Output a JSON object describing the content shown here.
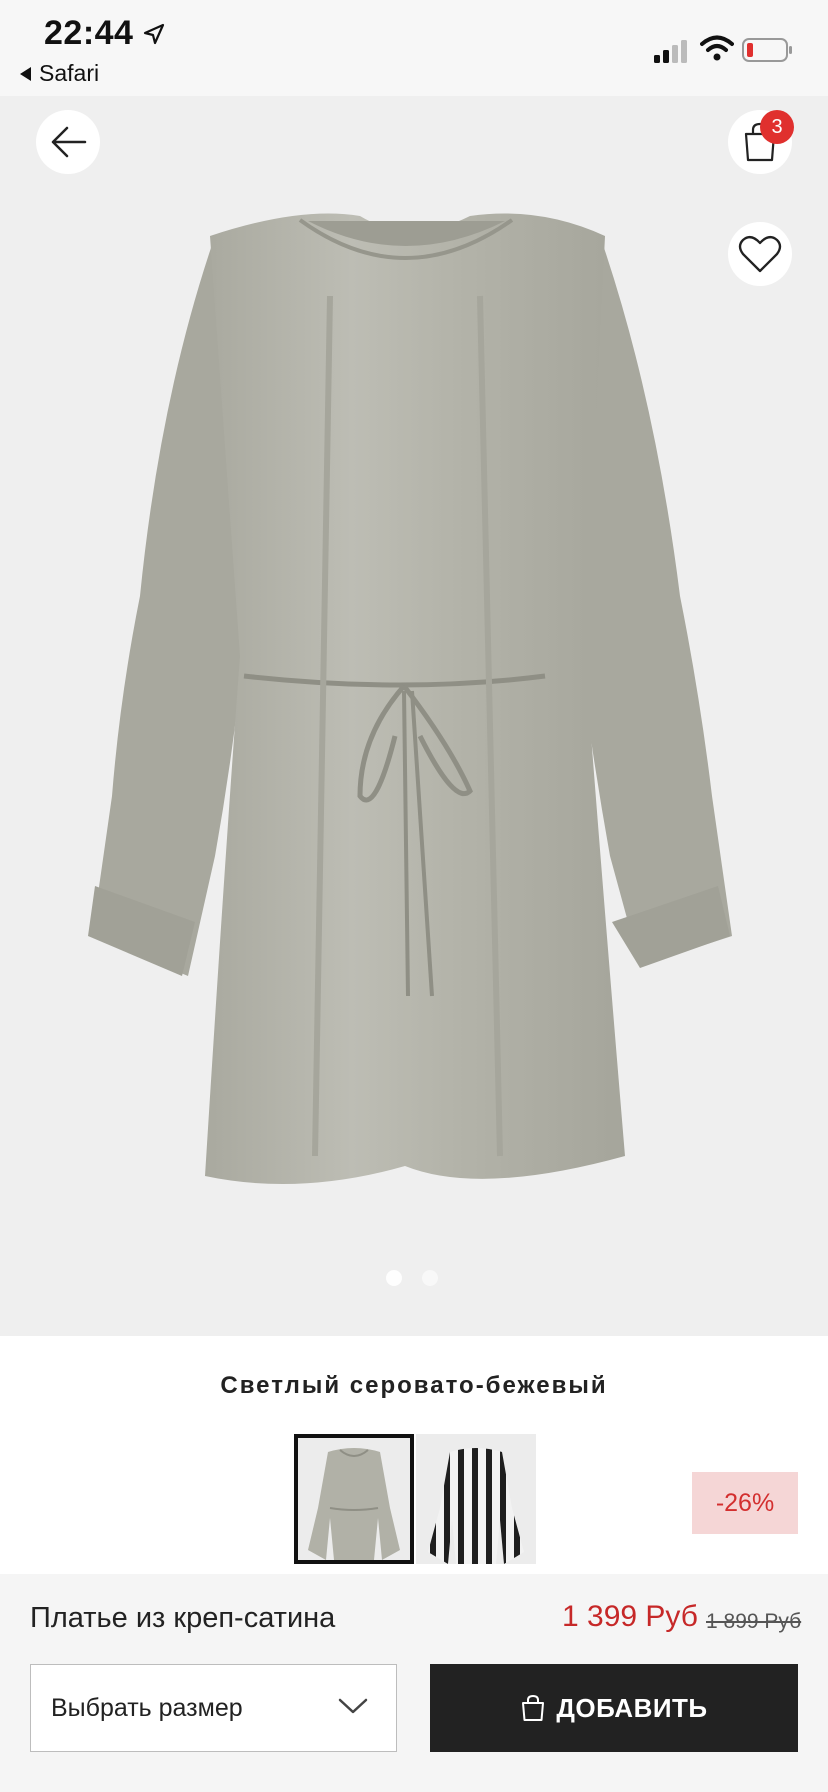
{
  "status_bar": {
    "time": "22:44",
    "back_app": "Safari",
    "icons": [
      "location-arrow-icon",
      "cellular-signal-icon",
      "wifi-icon",
      "battery-low-icon"
    ]
  },
  "header": {
    "cart_count": "3",
    "icons": [
      "back-arrow-icon",
      "shopping-bag-icon",
      "heart-icon"
    ]
  },
  "gallery": {
    "total_images": 2,
    "active_index": 0
  },
  "product": {
    "color_name": "Светлый серовато-бежевый",
    "discount": "-26%",
    "name": "Платье из креп-сатина",
    "price": "1 399 Руб",
    "old_price": "1 899 Руб",
    "swatches": [
      {
        "name": "light-greyish-beige",
        "selected": true
      },
      {
        "name": "black-white-stripe",
        "selected": false
      }
    ]
  },
  "actions": {
    "size_select": "Выбрать размер",
    "add_button": "ДОБАВИТЬ"
  },
  "colors": {
    "accent": "#c62828",
    "badge": "#e0302e",
    "add_button_bg": "#222222",
    "discount_bg": "#f5d6d6",
    "dress": "#b3b3aa"
  }
}
